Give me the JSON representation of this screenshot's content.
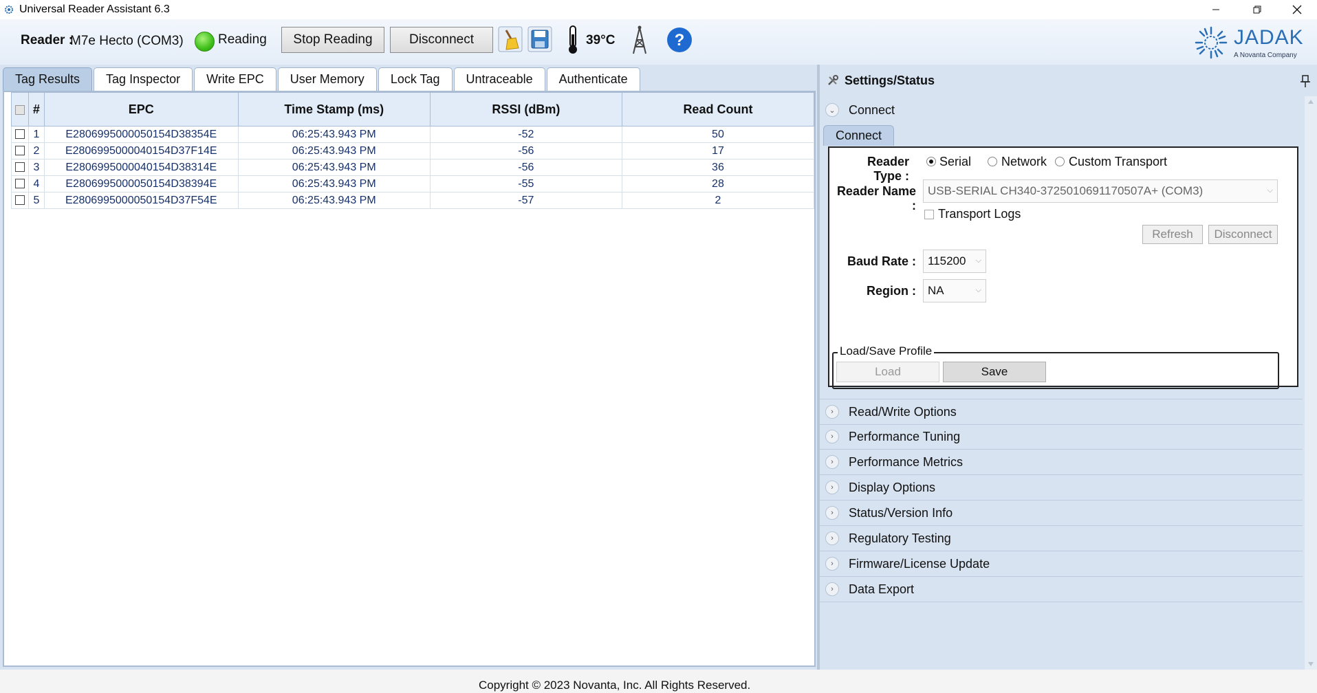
{
  "window": {
    "title": "Universal Reader Assistant 6.3",
    "controls": [
      "minimize-icon",
      "restore-icon",
      "close-icon"
    ]
  },
  "toolbar": {
    "reader_label": "Reader :",
    "reader_value": "M7e Hecto (COM3)",
    "status_text": "Reading",
    "status_color": "#3fbf1a",
    "stop_label": "Stop Reading",
    "disconnect_label": "Disconnect",
    "temperature": "39°C",
    "icons": [
      "broom-clear-icon",
      "save-disk-icon",
      "thermometer-icon",
      "antenna-tower-icon",
      "help-icon"
    ]
  },
  "logo": {
    "brand": "JADAK",
    "sub": "A Novanta Company"
  },
  "tabs": [
    {
      "label": "Tag Results",
      "active": true
    },
    {
      "label": "Tag Inspector",
      "active": false
    },
    {
      "label": "Write EPC",
      "active": false
    },
    {
      "label": "User Memory",
      "active": false
    },
    {
      "label": "Lock Tag",
      "active": false
    },
    {
      "label": "Untraceable",
      "active": false
    },
    {
      "label": "Authenticate",
      "active": false
    }
  ],
  "table": {
    "columns": [
      "#",
      "EPC",
      "Time Stamp (ms)",
      "RSSI (dBm)",
      "Read Count"
    ],
    "rows": [
      {
        "num": "1",
        "epc": "E2806995000050154D38354E",
        "time": "06:25:43.943 PM",
        "rssi": "-52",
        "count": "50"
      },
      {
        "num": "2",
        "epc": "E2806995000040154D37F14E",
        "time": "06:25:43.943 PM",
        "rssi": "-56",
        "count": "17"
      },
      {
        "num": "3",
        "epc": "E2806995000040154D38314E",
        "time": "06:25:43.943 PM",
        "rssi": "-56",
        "count": "36"
      },
      {
        "num": "4",
        "epc": "E2806995000050154D38394E",
        "time": "06:25:43.943 PM",
        "rssi": "-55",
        "count": "28"
      },
      {
        "num": "5",
        "epc": "E2806995000050154D37F54E",
        "time": "06:25:43.943 PM",
        "rssi": "-57",
        "count": "2"
      }
    ]
  },
  "settings": {
    "title": "Settings/Status",
    "connect_section": "Connect",
    "connect_subtab": "Connect",
    "reader_type_label": "Reader Type :",
    "reader_type_options": [
      "Serial",
      "Network",
      "Custom Transport"
    ],
    "reader_type_selected": "Serial",
    "reader_name_label": "Reader Name :",
    "reader_name_value": "USB-SERIAL CH340-3725010691170507A+ (COM3)",
    "transport_logs_label": "Transport Logs",
    "refresh_label": "Refresh",
    "disconnect_label": "Disconnect",
    "baud_rate_label": "Baud Rate :",
    "baud_rate_value": "115200",
    "region_label": "Region :",
    "region_value": "NA",
    "profile_legend": "Load/Save Profile",
    "load_label": "Load",
    "save_label": "Save",
    "collapsed_sections": [
      "Read/Write Options",
      "Performance Tuning",
      "Performance Metrics",
      "Display Options",
      "Status/Version Info",
      "Regulatory Testing",
      "Firmware/License Update",
      "Data Export"
    ]
  },
  "footer": {
    "copyright": "Copyright © 2023 Novanta, Inc. All Rights Reserved."
  }
}
